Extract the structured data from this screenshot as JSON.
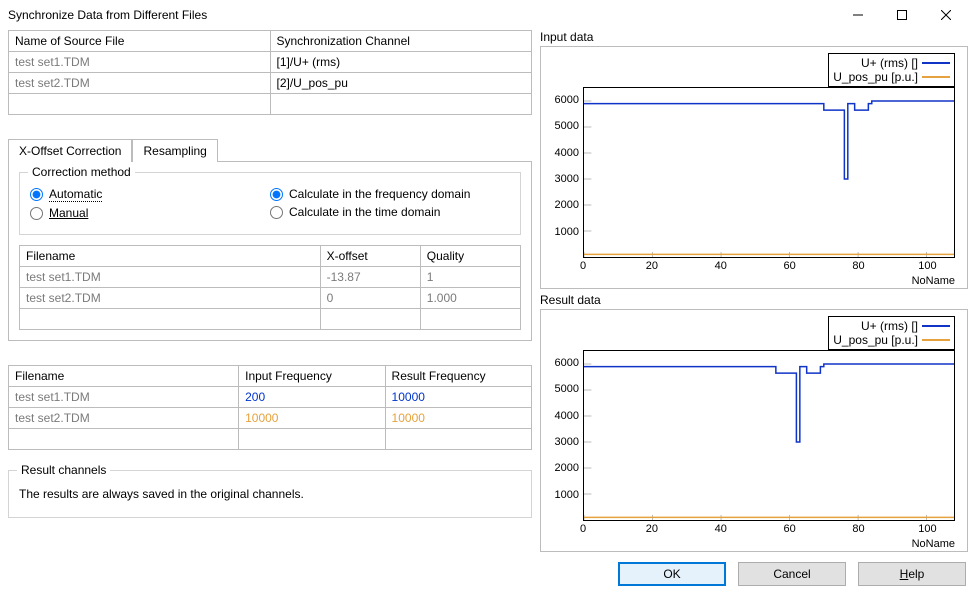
{
  "window": {
    "title": "Synchronize Data from Different Files"
  },
  "source_table": {
    "headers": [
      "Name of Source File",
      "Synchronization Channel"
    ],
    "rows": [
      {
        "file": "test set1.TDM",
        "channel": "[1]/U+ (rms)"
      },
      {
        "file": "test set2.TDM",
        "channel": "[2]/U_pos_pu"
      }
    ]
  },
  "tabs": {
    "a": "X-Offset Correction",
    "b": "Resampling"
  },
  "correction": {
    "legend": "Correction method",
    "automatic": "Automatic",
    "manual": "Manual",
    "freqdom": "Calculate in the frequency domain",
    "timedom": "Calculate in the time domain"
  },
  "offset_table": {
    "headers": [
      "Filename",
      "X-offset",
      "Quality"
    ],
    "rows": [
      {
        "file": "test set1.TDM",
        "xoff": "-13.87",
        "q": "1"
      },
      {
        "file": "test set2.TDM",
        "xoff": "0",
        "q": "1.000"
      }
    ]
  },
  "freq_table": {
    "headers": [
      "Filename",
      "Input Frequency",
      "Result Frequency"
    ],
    "rows": [
      {
        "file": "test set1.TDM",
        "in": "200",
        "out": "10000",
        "style": "blue"
      },
      {
        "file": "test set2.TDM",
        "in": "10000",
        "out": "10000",
        "style": "orange"
      }
    ]
  },
  "result_channels": {
    "legend": "Result channels",
    "text": "The results are always saved in the original channels."
  },
  "charts": {
    "input_title": "Input data",
    "result_title": "Result data",
    "legend_a": "U+ (rms) []",
    "legend_b": "U_pos_pu [p.u.]",
    "xlabel": "NoName",
    "colors": {
      "series_a": "#1034c8",
      "series_b": "#e6a23c"
    }
  },
  "chart_data": [
    {
      "name": "Input data",
      "type": "line",
      "xlabel": "NoName",
      "ylabel": "",
      "xlim": [
        0,
        108
      ],
      "ylim": [
        0,
        6500
      ],
      "xticks": [
        0,
        20,
        40,
        60,
        80,
        100
      ],
      "yticks": [
        1000,
        2000,
        3000,
        4000,
        5000,
        6000
      ],
      "series": [
        {
          "name": "U+ (rms) []",
          "color": "#1034c8",
          "points": [
            [
              0,
              5900
            ],
            [
              70,
              5900
            ],
            [
              70,
              5650
            ],
            [
              76,
              5650
            ],
            [
              76,
              3000
            ],
            [
              77,
              3000
            ],
            [
              77,
              5900
            ],
            [
              79,
              5900
            ],
            [
              79,
              5650
            ],
            [
              83,
              5650
            ],
            [
              83,
              5900
            ],
            [
              84,
              5900
            ],
            [
              84,
              6000
            ],
            [
              108,
              6000
            ]
          ]
        },
        {
          "name": "U_pos_pu [p.u.]",
          "color": "#e6a23c",
          "points": [
            [
              0,
              100
            ],
            [
              108,
              100
            ]
          ]
        }
      ]
    },
    {
      "name": "Result data",
      "type": "line",
      "xlabel": "NoName",
      "ylabel": "",
      "xlim": [
        0,
        108
      ],
      "ylim": [
        0,
        6500
      ],
      "xticks": [
        0,
        20,
        40,
        60,
        80,
        100
      ],
      "yticks": [
        1000,
        2000,
        3000,
        4000,
        5000,
        6000
      ],
      "series": [
        {
          "name": "U+ (rms) []",
          "color": "#1034c8",
          "points": [
            [
              0,
              5900
            ],
            [
              56,
              5900
            ],
            [
              56,
              5650
            ],
            [
              62,
              5650
            ],
            [
              62,
              3000
            ],
            [
              63,
              3000
            ],
            [
              63,
              5900
            ],
            [
              65,
              5900
            ],
            [
              65,
              5650
            ],
            [
              69,
              5650
            ],
            [
              69,
              5900
            ],
            [
              70,
              5900
            ],
            [
              70,
              6000
            ],
            [
              108,
              6000
            ]
          ]
        },
        {
          "name": "U_pos_pu [p.u.]",
          "color": "#e6a23c",
          "points": [
            [
              0,
              100
            ],
            [
              108,
              100
            ]
          ]
        }
      ]
    }
  ],
  "buttons": {
    "ok": "OK",
    "cancel": "Cancel",
    "help_prefix": "H",
    "help_rest": "elp"
  }
}
